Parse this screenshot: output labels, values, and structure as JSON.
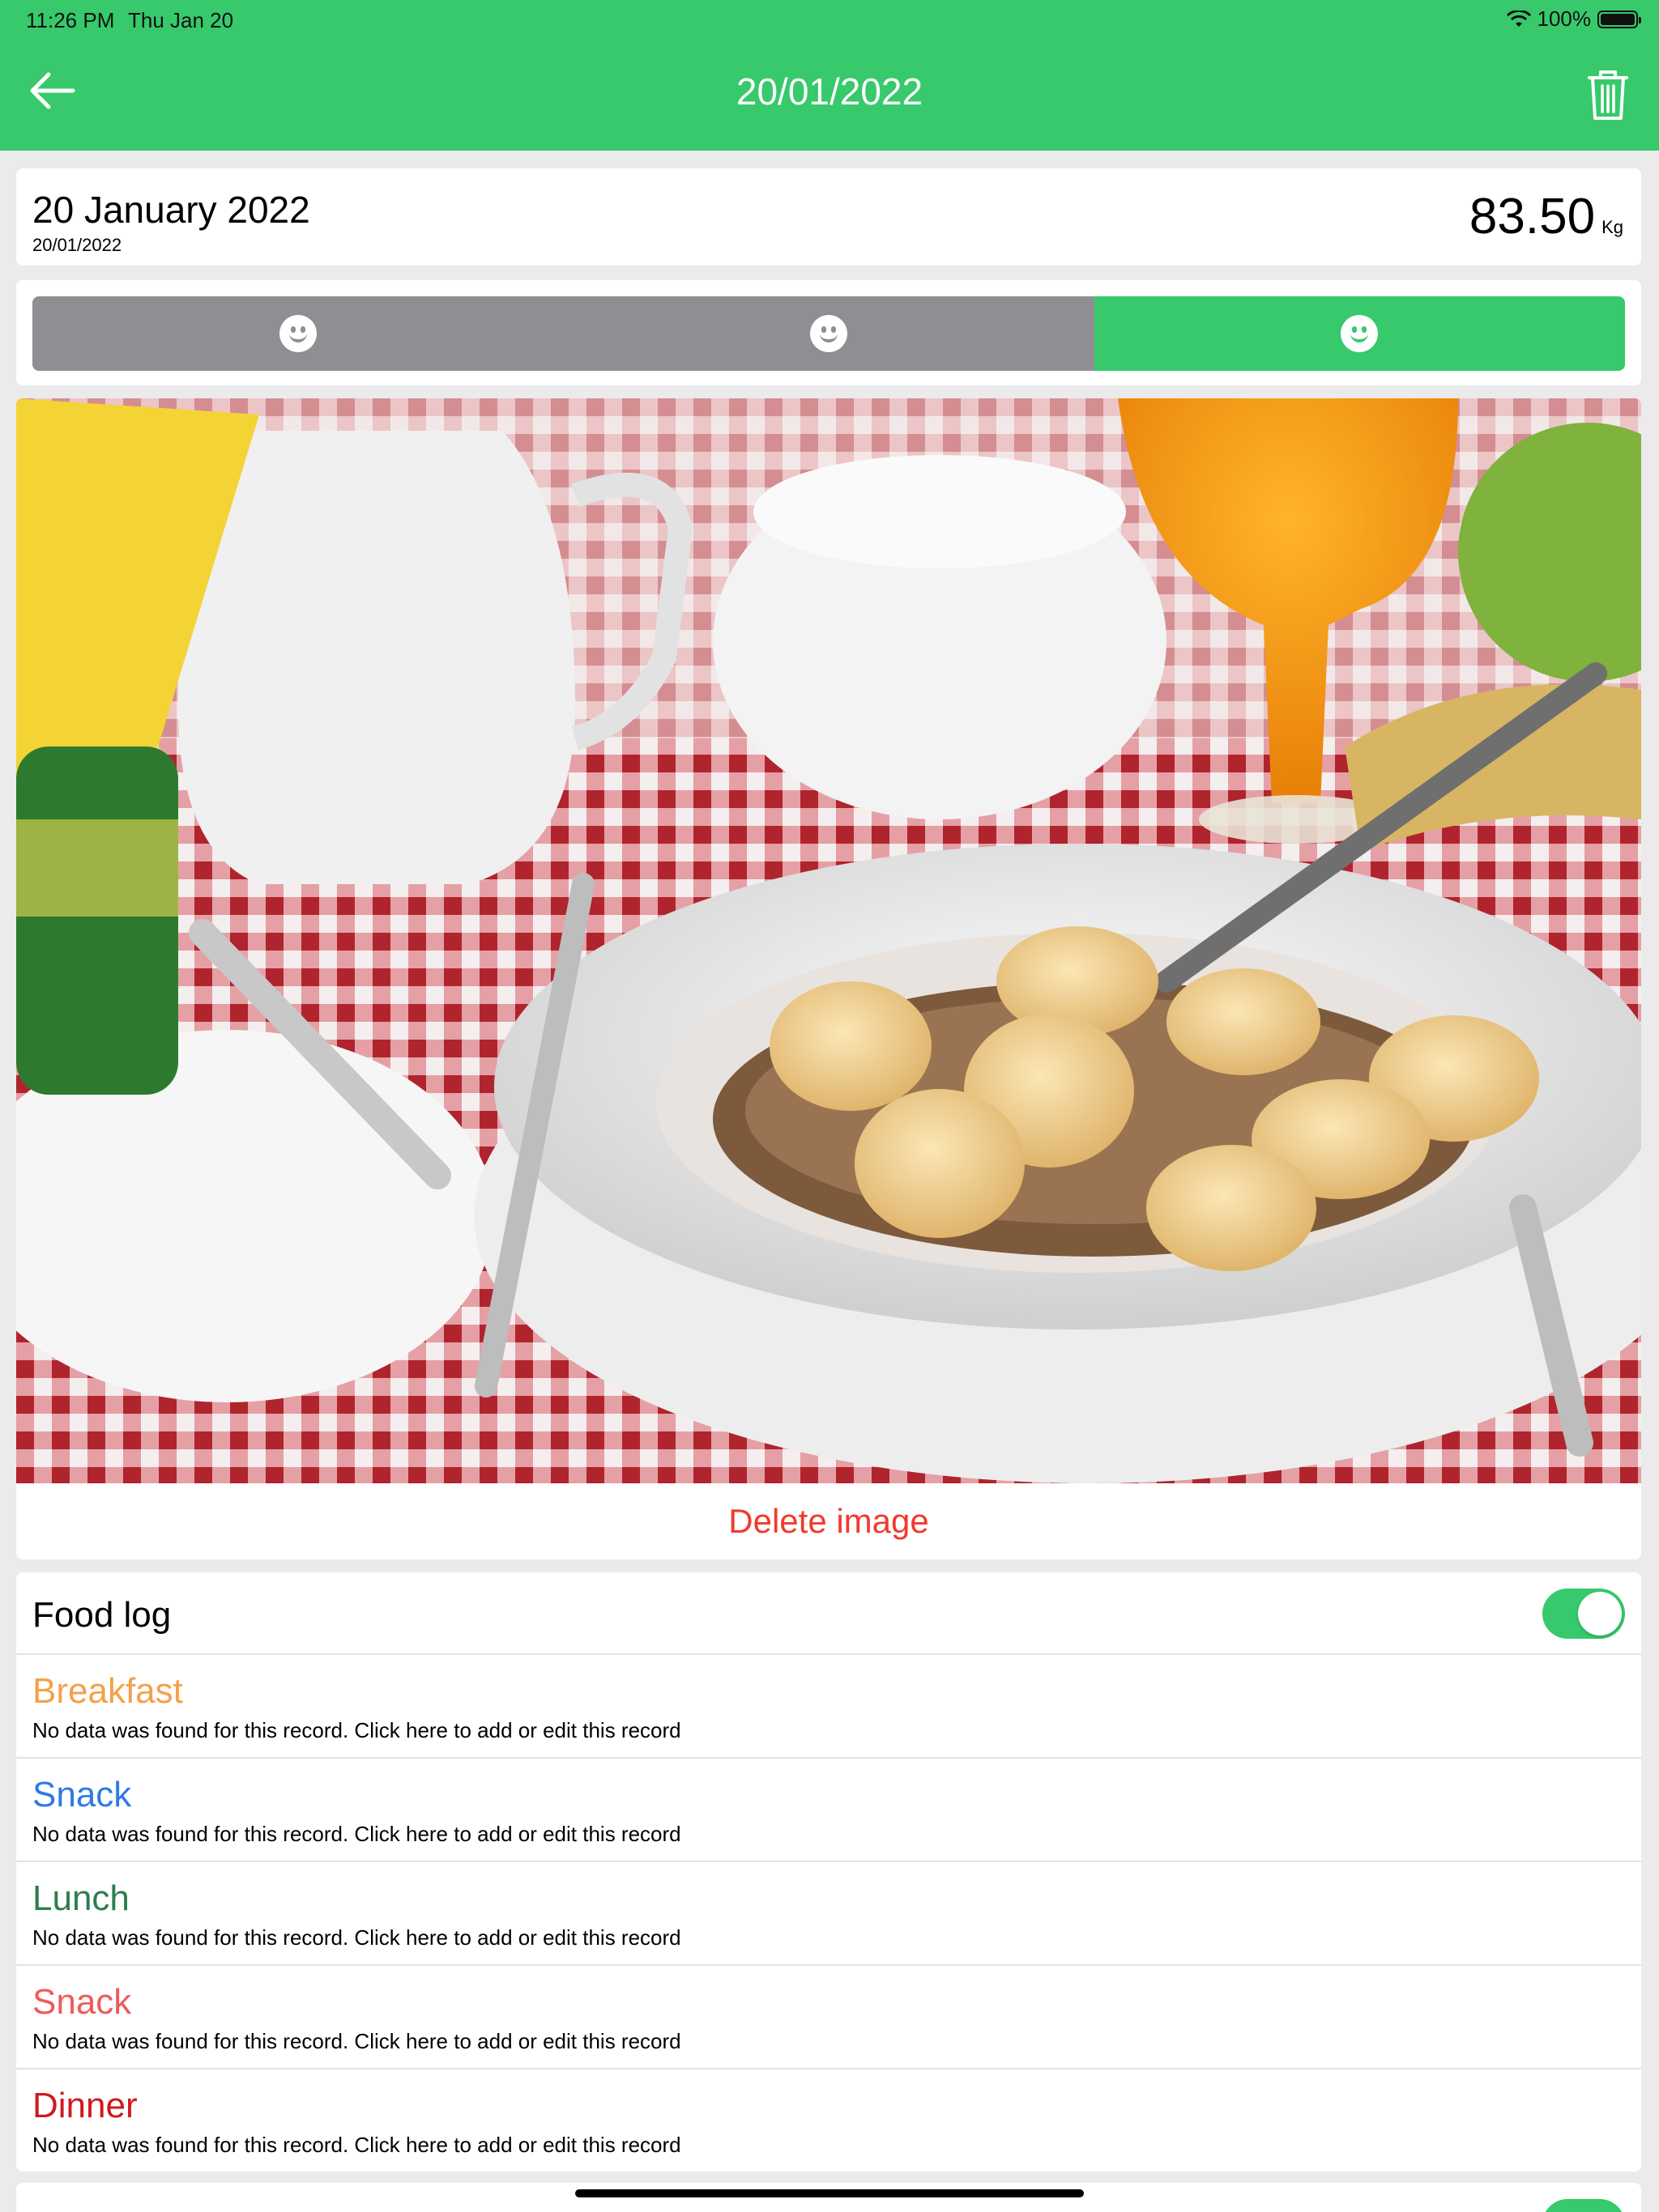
{
  "status_bar": {
    "time": "11:26 PM",
    "date": "Thu Jan 20",
    "battery": "100%"
  },
  "nav": {
    "title": "20/01/2022",
    "back_icon": "arrow-left-icon",
    "trash_icon": "trash-icon"
  },
  "entry": {
    "date_long": "20 January 2022",
    "date_short": "20/01/2022",
    "weight": "83.50",
    "weight_unit": "Kg"
  },
  "mood": {
    "options": [
      "smiley-icon",
      "smiley-icon",
      "smiley-icon"
    ],
    "selected_index": 2
  },
  "image": {
    "delete_label": "Delete image"
  },
  "food_log": {
    "title": "Food log",
    "enabled": true,
    "meals": [
      {
        "name": "Breakfast",
        "color": "#f5a04a",
        "desc": "No data was found for this record. Click here to add or edit this record"
      },
      {
        "name": "Snack",
        "color": "#2f7ae5",
        "desc": "No data was found for this record. Click here to add or edit this record"
      },
      {
        "name": "Lunch",
        "color": "#2e7d4f",
        "desc": "No data was found for this record. Click here to add or edit this record"
      },
      {
        "name": "Snack",
        "color": "#f05a5a",
        "desc": "No data was found for this record. Click here to add or edit this record"
      },
      {
        "name": "Dinner",
        "color": "#d0191c",
        "desc": "No data was found for this record. Click here to add or edit this record"
      }
    ]
  },
  "colors": {
    "accent": "#37c96b",
    "destructive": "#f03a2e",
    "inactive": "#8e8e93"
  }
}
